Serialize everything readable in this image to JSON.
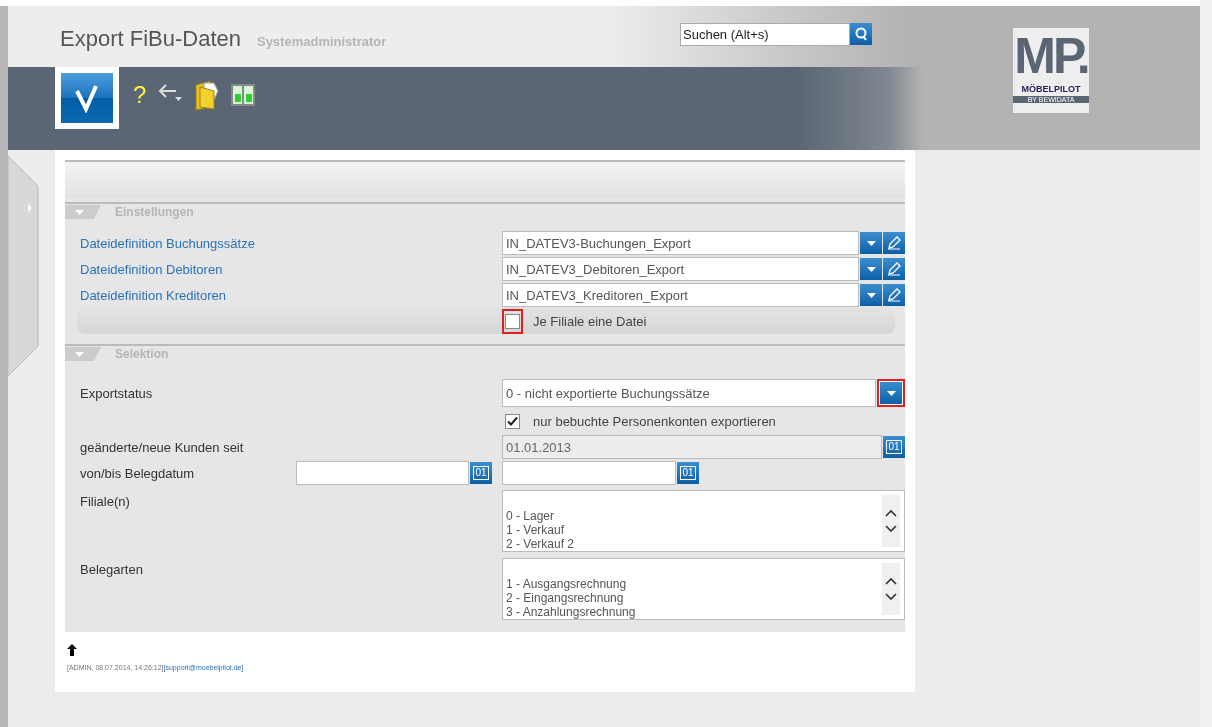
{
  "header": {
    "title": "Export FiBu-Daten",
    "subtitle": "Systemadministrator",
    "search": {
      "placeholder": "Suchen (Alt+s)"
    },
    "toolbar": {
      "help_symbol": "?"
    },
    "logo": {
      "mark": "MP.",
      "name": "MÖBELPILOT",
      "tagline": "BY BEWIDATA"
    }
  },
  "sections": [
    {
      "title": "Einstellungen",
      "expanded": true,
      "rows": [
        {
          "kind": "select_edit",
          "label": "Dateidefinition Buchungssätze",
          "value": "IN_DATEV3-Buchungen_Export"
        },
        {
          "kind": "select_edit",
          "label": "Dateidefinition Debitoren",
          "value": "IN_DATEV3_Debitoren_Export"
        },
        {
          "kind": "select_edit",
          "label": "Dateidefinition Kreditoren",
          "value": "IN_DATEV3_Kreditoren_Export"
        },
        {
          "kind": "checkbox",
          "label": "Je Filiale eine Datei",
          "checked": false,
          "highlighted": true
        }
      ]
    },
    {
      "title": "Selektion",
      "expanded": true,
      "rows": [
        {
          "kind": "select",
          "label": "Exportstatus",
          "value": "0 - nicht exportierte Buchungssätze",
          "highlighted": true
        },
        {
          "kind": "checkbox",
          "label": "nur bebuchte Personenkonten exportieren",
          "checked": true
        },
        {
          "kind": "date",
          "label": "geänderte/neue Kunden seit",
          "value": "01.01.2013",
          "disabled": true,
          "calendar_symbol": "01"
        },
        {
          "kind": "date_range",
          "label": "von/bis Belegdatum",
          "calendar_symbols": [
            "01",
            "01"
          ]
        },
        {
          "kind": "list",
          "label": "Filiale(n)",
          "items": [
            "0 - Lager",
            "1 - Verkauf",
            "2 - Verkauf 2"
          ]
        },
        {
          "kind": "list",
          "label": "Belegarten",
          "items": [
            "1 - Ausgangsrechnung",
            "2 - Eingangsrechnung",
            "3 - Anzahlungsrechnung"
          ]
        }
      ]
    }
  ],
  "footer": {
    "info": "[ADMIN, 08.07.2014, 14:26:12]",
    "link": "[support@moebelpilot.de]"
  }
}
